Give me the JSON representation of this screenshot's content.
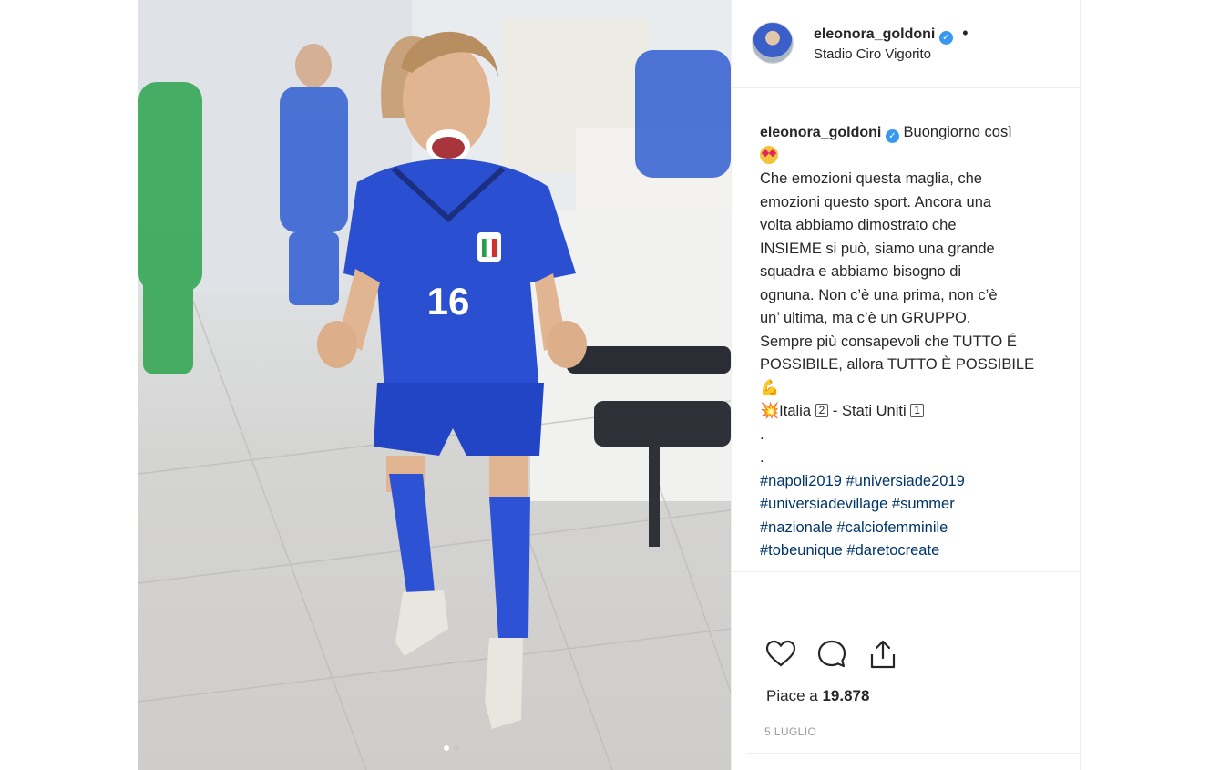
{
  "post": {
    "username": "eleonora_goldoni",
    "verified_icon": "check-icon",
    "separator": "•",
    "location": "Stadio Ciro Vigorito",
    "photo": {
      "jersey_number": "16",
      "kit_color": "#2a4fd0",
      "carousel": {
        "count": 2,
        "active": 1
      }
    },
    "caption": {
      "username": "eleonora_goldoni",
      "lines": [
        "Buongiorno così",
        "Che emozioni questa maglia, che",
        "emozioni questo sport. Ancora una",
        "volta abbiamo dimostrato che",
        "INSIEME si può, siamo una grande",
        "squadra e abbiamo bisogno di",
        "ognuna. Non c’è una prima, non c’è",
        "un’ ultima, ma c’è un GRUPPO.",
        "Sempre più consapevoli che TUTTO É",
        "POSSIBILE, allora TUTTO È POSSIBILE"
      ],
      "score": {
        "team1": "Italia",
        "score1": "2",
        "dash": "-",
        "team2": "Stati Uniti",
        "score2": "1"
      },
      "dots": [
        ".",
        "."
      ],
      "hashtags": [
        "#napoli2019 #universiade2019",
        "#universiadevillage #summer",
        "#nazionale #calciofemminile",
        "#tobeunique #daretocreate"
      ],
      "emoji_icons": [
        "heart-eyes-emoji",
        "flexed-biceps-emoji",
        "collision-emoji"
      ]
    },
    "actions": {
      "like_icon": "heart-icon",
      "comment_icon": "comment-icon",
      "share_icon": "share-icon"
    },
    "likes": {
      "prefix": "Piace a",
      "count": "19.878"
    },
    "date": "5 LUGLIO",
    "colors": {
      "link": "#003569",
      "verified": "#3897f0",
      "border": "#efefef"
    }
  }
}
